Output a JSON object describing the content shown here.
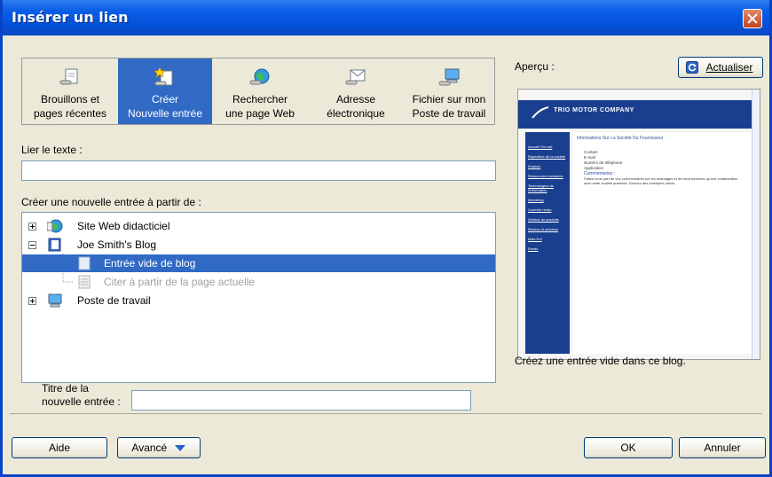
{
  "window": {
    "title": "Insérer un lien"
  },
  "toolbar": {
    "items": [
      {
        "label": "Brouillons et\npages récentes",
        "icon": "drafts-icon"
      },
      {
        "label": "Créer\nNouvelle entrée",
        "icon": "new-entry-icon",
        "selected": true
      },
      {
        "label": "Rechercher\nune page Web",
        "icon": "globe-icon"
      },
      {
        "label": "Adresse\nélectronique",
        "icon": "envelope-icon"
      },
      {
        "label": "Fichier sur mon\nPoste de travail",
        "icon": "computer-icon"
      }
    ]
  },
  "link_text": {
    "label": "Lier le texte :",
    "value": ""
  },
  "create_from": {
    "label": "Créer une nouvelle entrée à partir de :"
  },
  "tree": {
    "items": [
      {
        "label": "Site Web didacticiel",
        "icon": "website-icon",
        "expander": "plus"
      },
      {
        "label": "Joe Smith's Blog",
        "icon": "blog-icon",
        "expander": "minus"
      },
      {
        "label": "Entrée vide de blog",
        "icon": "blank-entry-icon",
        "selected": true
      },
      {
        "label": "Citer à partir de la page actuelle",
        "icon": "quote-page-icon",
        "disabled": true
      },
      {
        "label": "Poste de travail",
        "icon": "computer-icon",
        "expander": "plus"
      }
    ]
  },
  "entry_title": {
    "label": "Titre de la\nnouvelle entrée :",
    "value": ""
  },
  "preview": {
    "label": "Aperçu :",
    "refresh_label": "Actualiser",
    "description": "Créez une entrée vide dans ce blog.",
    "page_brand": "TRIO MOTOR COMPANY",
    "page_heading": "Informations Sur La Société Du Fournisseur",
    "page_nav": [
      "Accueil Trio.net",
      "Répertoire de la société",
      "Emplois",
      "Ressources humaines",
      "Technologies de l'information",
      "Marketing",
      "Contrôle rendu",
      "Gestion de produits",
      "Réseau et services",
      "Mais Ent",
      "Rosés"
    ],
    "page_fields": [
      "Contact",
      "E-mail",
      "Numéro de téléphone",
      "Application"
    ],
    "page_comments_title": "Commentaires :",
    "page_comments_text": "Faites nous part de vos commentaires sur les avantages et les inconvénients qu'une collaboration avec cette société présente. Donnez des exemples précis."
  },
  "buttons": {
    "help": "Aide",
    "advanced": "Avancé",
    "ok": "OK",
    "cancel": "Annuler"
  },
  "colors": {
    "title_bar": "#0a5ee6",
    "selection": "#316ac5",
    "dialog_bg": "#ece9d8"
  }
}
